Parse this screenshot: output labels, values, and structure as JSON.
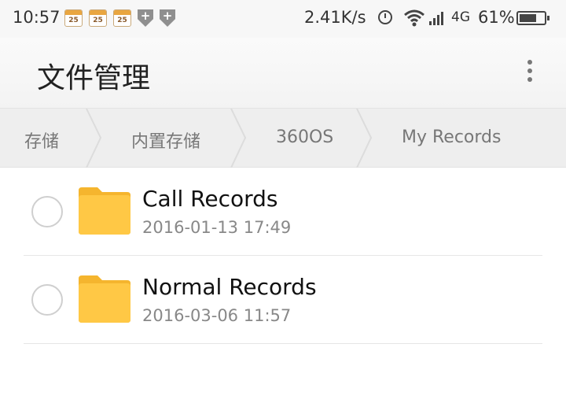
{
  "status_bar": {
    "time": "10:57",
    "calendar_day": "25",
    "net_speed": "2.41K/s",
    "network_type": "4G",
    "battery_percent": "61%"
  },
  "app_bar": {
    "title": "文件管理"
  },
  "breadcrumb": [
    "存储",
    "内置存储",
    "360OS",
    "My Records"
  ],
  "files": [
    {
      "name": "Call Records",
      "date": "2016-01-13 17:49",
      "type": "folder"
    },
    {
      "name": "Normal Records",
      "date": "2016-03-06 11:57",
      "type": "folder"
    }
  ],
  "colors": {
    "folder": "#FFC845",
    "folder_tab": "#F5B52E",
    "breadcrumb_bg": "#EEEEEE",
    "appbar_bg": "#F5F5F5"
  }
}
